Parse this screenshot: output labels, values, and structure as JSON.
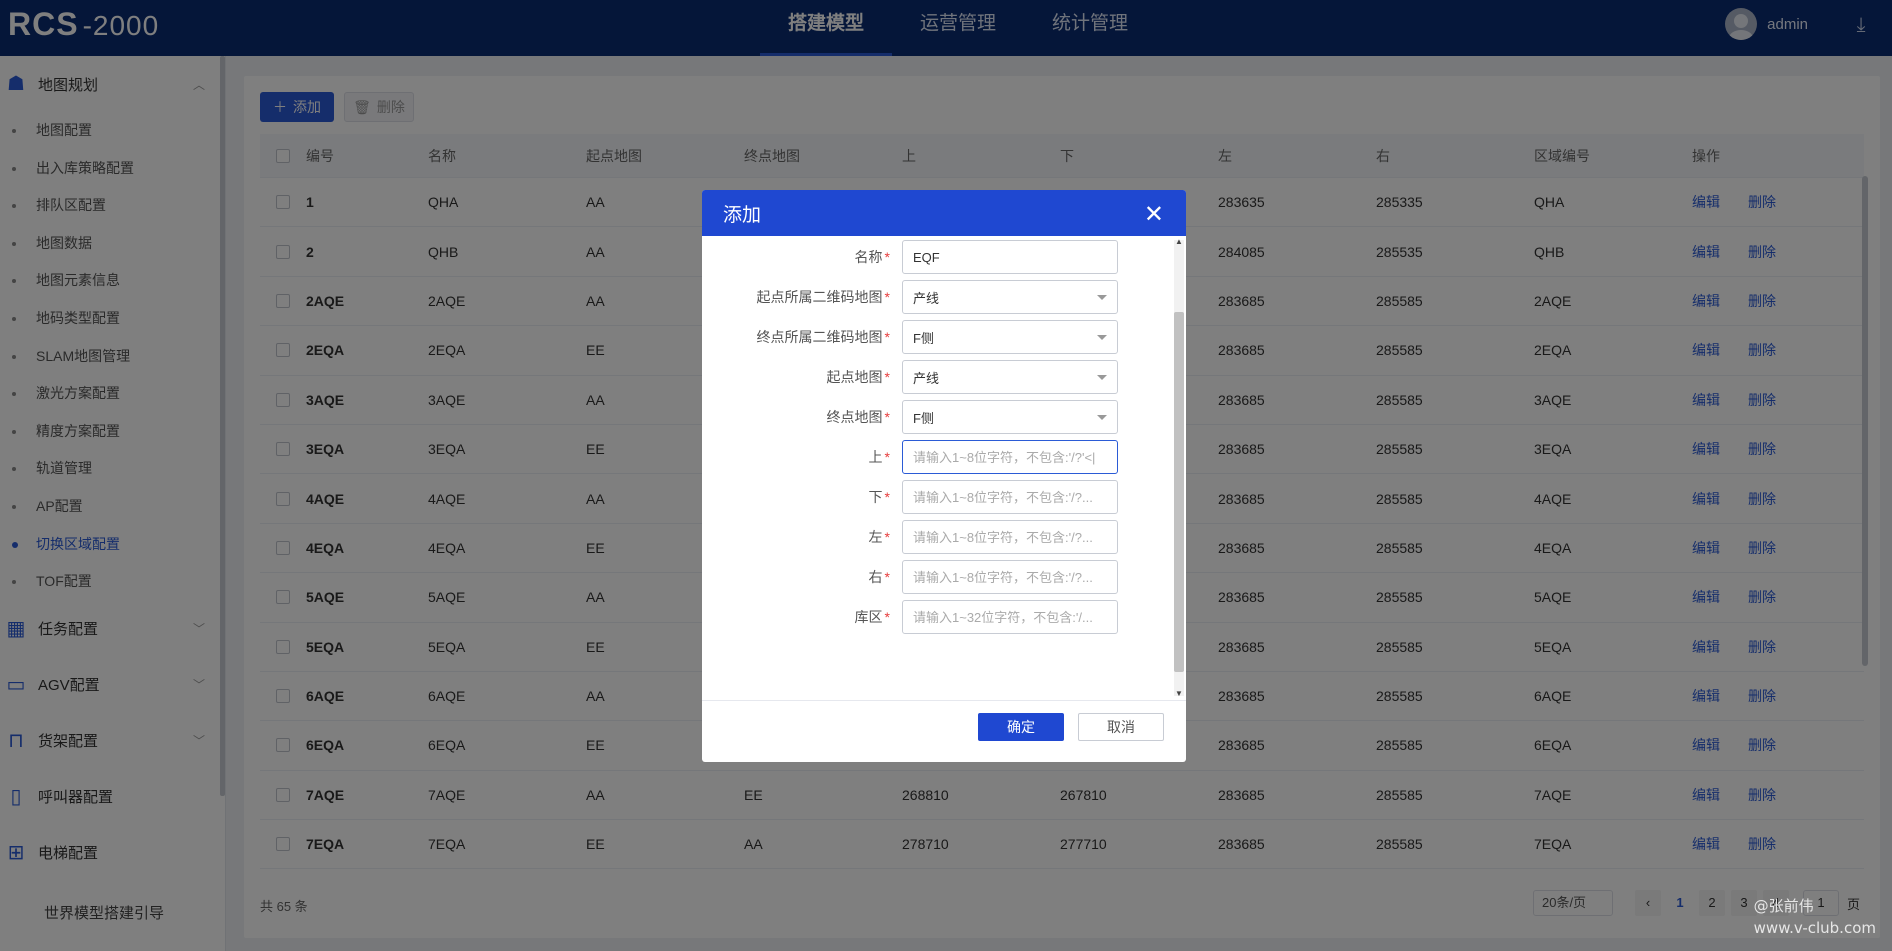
{
  "app": {
    "logo": "RCS",
    "logo_sub": "-2000"
  },
  "topnav": [
    {
      "label": "搭建模型",
      "active": true
    },
    {
      "label": "运营管理",
      "active": false
    },
    {
      "label": "统计管理",
      "active": false
    }
  ],
  "user": {
    "name": "admin"
  },
  "sidebar": {
    "group_map": "地图规划",
    "items": [
      "地图配置",
      "出入库策略配置",
      "排队区配置",
      "地图数据",
      "地图元素信息",
      "地码类型配置",
      "SLAM地图管理",
      "激光方案配置",
      "精度方案配置",
      "轨道管理",
      "AP配置",
      "切换区域配置",
      "TOF配置"
    ],
    "active_index": 11,
    "groups": [
      "任务配置",
      "AGV配置",
      "货架配置",
      "呼叫器配置",
      "电梯配置"
    ],
    "guide": "世界模型搭建引导"
  },
  "toolbar": {
    "add_label": "添加",
    "delete_label": "删除"
  },
  "table": {
    "headers": [
      "编号",
      "名称",
      "起点地图",
      "终点地图",
      "上",
      "下",
      "左",
      "右",
      "区域编号",
      "操作"
    ],
    "actions": {
      "edit": "编辑",
      "delete": "删除"
    },
    "rows": [
      [
        "1",
        "QHA",
        "AA",
        "",
        "",
        "",
        "283635",
        "285335",
        "QHA"
      ],
      [
        "2",
        "QHB",
        "AA",
        "",
        "",
        "",
        "284085",
        "285535",
        "QHB"
      ],
      [
        "2AQE",
        "2AQE",
        "AA",
        "",
        "",
        "",
        "283685",
        "285585",
        "2AQE"
      ],
      [
        "2EQA",
        "2EQA",
        "EE",
        "",
        "",
        "",
        "283685",
        "285585",
        "2EQA"
      ],
      [
        "3AQE",
        "3AQE",
        "AA",
        "",
        "",
        "",
        "283685",
        "285585",
        "3AQE"
      ],
      [
        "3EQA",
        "3EQA",
        "EE",
        "",
        "",
        "",
        "283685",
        "285585",
        "3EQA"
      ],
      [
        "4AQE",
        "4AQE",
        "AA",
        "",
        "",
        "",
        "283685",
        "285585",
        "4AQE"
      ],
      [
        "4EQA",
        "4EQA",
        "EE",
        "",
        "",
        "",
        "283685",
        "285585",
        "4EQA"
      ],
      [
        "5AQE",
        "5AQE",
        "AA",
        "",
        "",
        "",
        "283685",
        "285585",
        "5AQE"
      ],
      [
        "5EQA",
        "5EQA",
        "EE",
        "",
        "",
        "",
        "283685",
        "285585",
        "5EQA"
      ],
      [
        "6AQE",
        "6AQE",
        "AA",
        "",
        "",
        "",
        "283685",
        "285585",
        "6AQE"
      ],
      [
        "6EQA",
        "6EQA",
        "EE",
        "",
        "",
        "",
        "283685",
        "285585",
        "6EQA"
      ],
      [
        "7AQE",
        "7AQE",
        "AA",
        "EE",
        "268810",
        "267810",
        "283685",
        "285585",
        "7AQE"
      ],
      [
        "7EQA",
        "7EQA",
        "EE",
        "AA",
        "278710",
        "277710",
        "283685",
        "285585",
        "7EQA"
      ]
    ]
  },
  "footer": {
    "total": "共 65 条",
    "page_size": "20条/页",
    "pages": [
      "1",
      "2",
      "3",
      "4"
    ],
    "goto_value": "1",
    "goto_suffix": "页"
  },
  "dialog": {
    "title": "添加",
    "fields": [
      {
        "label": "名称",
        "value": "EQF",
        "placeholder": "",
        "type": "input"
      },
      {
        "label": "起点所属二维码地图",
        "value": "产线",
        "type": "select"
      },
      {
        "label": "终点所属二维码地图",
        "value": "F侧",
        "type": "select"
      },
      {
        "label": "起点地图",
        "value": "产线",
        "type": "select"
      },
      {
        "label": "终点地图",
        "value": "F侧",
        "type": "select"
      },
      {
        "label": "上",
        "value": "",
        "placeholder": "请输入1~8位字符，不包含:'/?'<|",
        "type": "input"
      },
      {
        "label": "下",
        "value": "",
        "placeholder": "请输入1~8位字符，不包含:'/?...",
        "type": "input"
      },
      {
        "label": "左",
        "value": "",
        "placeholder": "请输入1~8位字符，不包含:'/?...",
        "type": "input"
      },
      {
        "label": "右",
        "value": "",
        "placeholder": "请输入1~8位字符，不包含:'/?...",
        "type": "input"
      },
      {
        "label": "库区",
        "value": "",
        "placeholder": "请输入1~32位字符，不包含:'/...",
        "type": "input"
      }
    ],
    "ok_label": "确定",
    "cancel_label": "取消"
  },
  "watermark": {
    "line1": "@张前伟",
    "line2": "www.v-club.com"
  }
}
